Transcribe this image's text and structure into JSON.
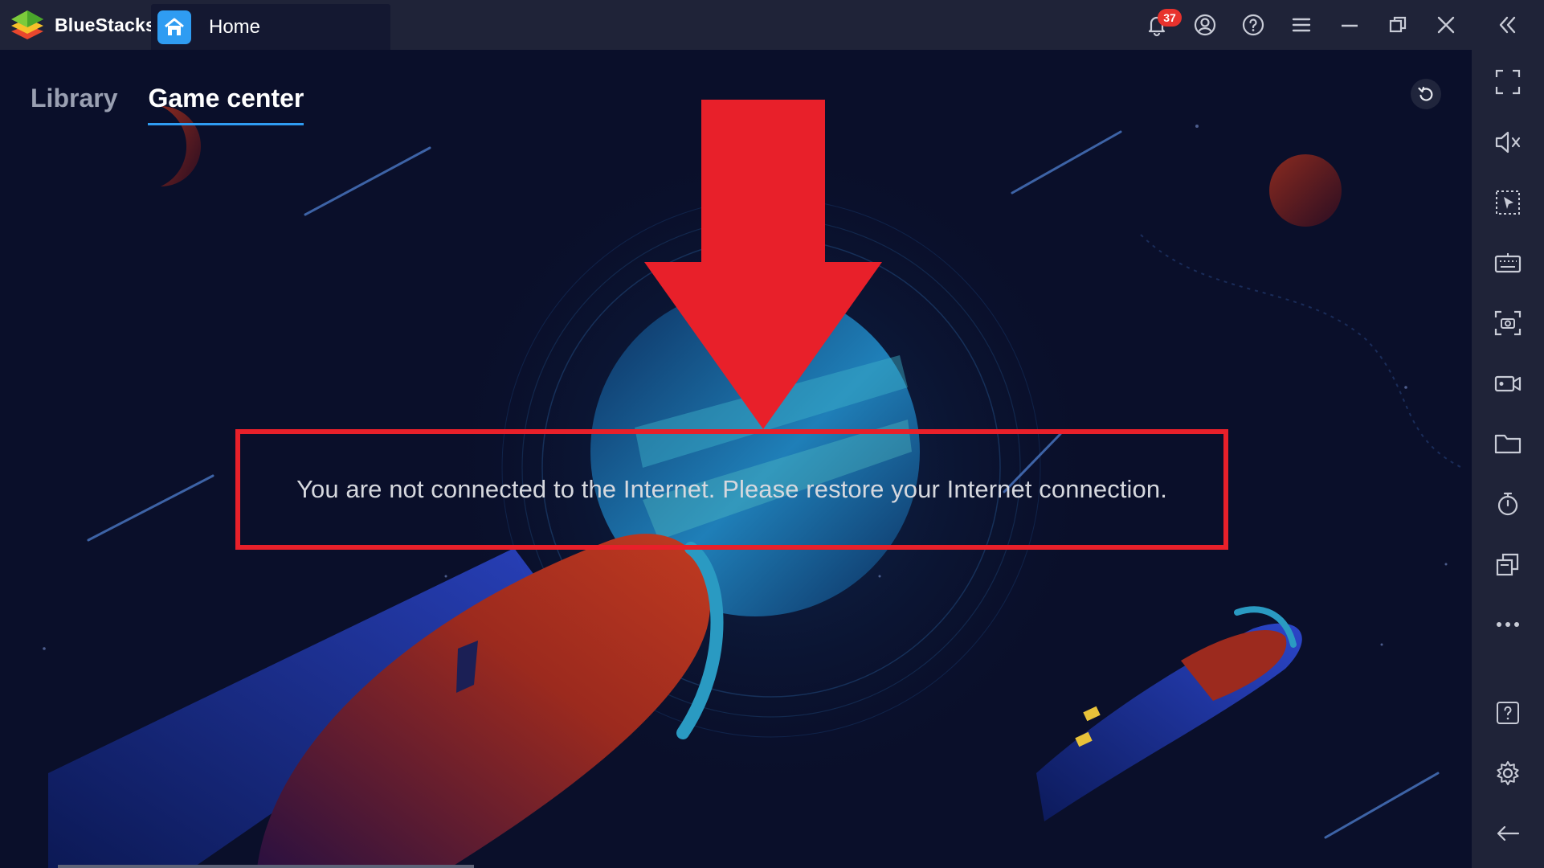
{
  "titlebar": {
    "app_name": "BlueStacks",
    "tab_label": "Home",
    "notification_count": "37",
    "icons": [
      "bell-icon",
      "account-icon",
      "help-icon",
      "menu-icon",
      "minimize-icon",
      "restore-icon",
      "close-icon",
      "collapse-sidebar-icon"
    ]
  },
  "main": {
    "tabs": [
      {
        "label": "Library",
        "active": false
      },
      {
        "label": "Game center",
        "active": true
      }
    ],
    "message": "You are not connected to the Internet. Please restore your Internet connection."
  },
  "sidebar": {
    "icons": [
      "fullscreen-icon",
      "mute-icon",
      "pointer-icon",
      "keyboard-icon",
      "screenshot-icon",
      "record-icon",
      "folder-icon",
      "timer-icon",
      "multi-instance-icon",
      "more-icon",
      "help-icon",
      "settings-icon",
      "back-icon"
    ]
  },
  "colors": {
    "titlebar": "#1f2338",
    "background": "#0a0f2a",
    "accent": "#2f9cf2",
    "annotation": "#e8202a",
    "badge": "#e8322d"
  }
}
